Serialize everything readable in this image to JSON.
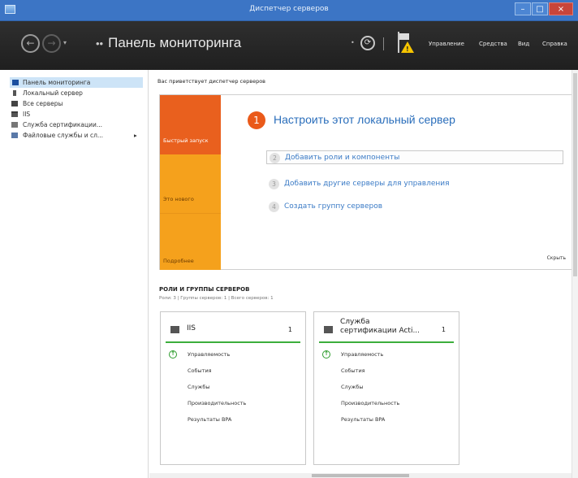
{
  "window": {
    "title": "Диспетчер серверов",
    "controls": {
      "minimize": "–",
      "maximize": "□",
      "close": "×"
    }
  },
  "toolbar": {
    "breadcrumb_prefix": "••",
    "breadcrumb": "Панель мониторинга",
    "refresh_icon": "refresh-icon",
    "notifications_icon": "flag-warning-icon",
    "menus": [
      "Управление",
      "Средства",
      "Вид",
      "Справка"
    ]
  },
  "sidebar": {
    "items": [
      {
        "label": "Панель мониторинга",
        "icon": "dashboard-icon",
        "active": true
      },
      {
        "label": "Локальный сервер",
        "icon": "server-icon"
      },
      {
        "label": "Все серверы",
        "icon": "servers-icon"
      },
      {
        "label": "IIS",
        "icon": "iis-icon"
      },
      {
        "label": "Служба сертификации...",
        "icon": "certificate-icon"
      },
      {
        "label": "Файловые службы и сл...",
        "icon": "file-services-icon",
        "has_arrow": true
      }
    ]
  },
  "main": {
    "welcome": "Вас приветствует диспетчер серверов",
    "quickstart": {
      "tabs": [
        "Быстрый запуск",
        "Это нового",
        "Подробнее"
      ],
      "step_number": "1",
      "title": "Настроить этот локальный сервер",
      "steps": [
        {
          "num": "2",
          "label": "Добавить роли и компоненты"
        },
        {
          "num": "3",
          "label": "Добавить другие серверы для управления"
        },
        {
          "num": "4",
          "label": "Создать группу серверов"
        }
      ],
      "hide": "Скрыть"
    },
    "roles": {
      "heading": "РОЛИ И ГРУППЫ СЕРВЕРОВ",
      "subheading": "Роли: 3 | Группы серверов: 1 | Всего серверов: 1",
      "tiles": [
        {
          "name": "IIS",
          "count": "1",
          "icon": "iis-icon",
          "rows": [
            "Управляемость",
            "События",
            "Службы",
            "Производительность",
            "Результаты BPA"
          ]
        },
        {
          "name_line1": "Служба",
          "name_line2": "сертификации Acti...",
          "count": "1",
          "icon": "certificate-icon",
          "rows": [
            "Управляемость",
            "События",
            "Службы",
            "Производительность",
            "Результаты BPA"
          ]
        }
      ]
    }
  },
  "colors": {
    "toolbar_bg": "#262626",
    "titlebar_bg": "#3c75c5",
    "accent_orange": "#e9601e",
    "accent_amber": "#f5a11c",
    "link_blue": "#3b7bc6",
    "status_green": "#3cae3c"
  }
}
